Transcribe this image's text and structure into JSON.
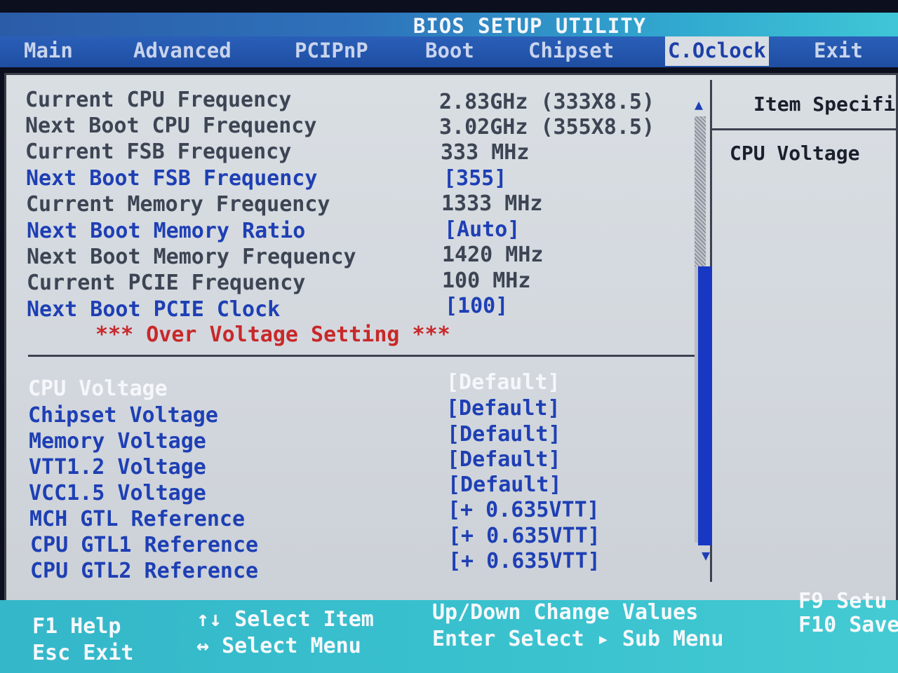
{
  "title": "BIOS SETUP UTILITY",
  "menu": [
    {
      "label": "Main"
    },
    {
      "label": "Advanced"
    },
    {
      "label": "PCIPnP"
    },
    {
      "label": "Boot"
    },
    {
      "label": "Chipset"
    },
    {
      "label": "C.Oclock",
      "active": true
    },
    {
      "label": "Exit"
    }
  ],
  "info_rows": [
    {
      "label": "Current CPU Frequency",
      "value": "2.83GHz (333X8.5)",
      "editable": false
    },
    {
      "label": "Next Boot CPU Frequency",
      "value": "3.02GHz (355X8.5)",
      "editable": false
    },
    {
      "label": "Current FSB Frequency",
      "value": "333 MHz",
      "editable": false
    },
    {
      "label": "Next Boot FSB Frequency",
      "value": "[355]",
      "editable": true
    },
    {
      "label": "Current Memory Frequency",
      "value": "1333 MHz",
      "editable": false
    },
    {
      "label": "Next Boot Memory Ratio",
      "value": "[Auto]",
      "editable": true
    },
    {
      "label": "Next Boot Memory Frequency",
      "value": "1420 MHz",
      "editable": false
    },
    {
      "label": "Current PCIE Frequency",
      "value": "100 MHz",
      "editable": false
    },
    {
      "label": "Next Boot PCIE Clock",
      "value": "[100]",
      "editable": true
    }
  ],
  "section_header": "*** Over Voltage Setting ***",
  "voltage_rows": [
    {
      "label": "CPU Voltage",
      "value": "[Default]",
      "selected": true
    },
    {
      "label": "Chipset Voltage",
      "value": "[Default]"
    },
    {
      "label": "Memory Voltage",
      "value": "[Default]"
    },
    {
      "label": "VTT1.2 Voltage",
      "value": "[Default]"
    },
    {
      "label": "VCC1.5 Voltage",
      "value": "[Default]"
    },
    {
      "label": "MCH GTL Reference",
      "value": "[+ 0.635VTT]"
    },
    {
      "label": "CPU GTL1 Reference",
      "value": "[+ 0.635VTT]"
    },
    {
      "label": "CPU GTL2 Reference",
      "value": "[+ 0.635VTT]"
    }
  ],
  "help_panel": {
    "title": "Item Specifi",
    "text": "CPU Voltage"
  },
  "scrollbar": {
    "up_arrow": "▲",
    "down_arrow": "▼"
  },
  "keys": {
    "f1": "F1  Help",
    "esc": "Esc Exit",
    "select_item": "↑↓ Select Item",
    "select_menu": "↔ Select Menu",
    "updown": "Up/Down Change Values",
    "enter": "Enter   Select ▸ Sub Menu",
    "f9": "F9  Setu",
    "f10": "F10 Save"
  },
  "colors": {
    "panel_bg": "#d5dadf",
    "menu_bg": "#2a5fb8",
    "status_bg": "#3ac2cf",
    "label_gray": "#3d4554",
    "label_blue": "#1e3fb4",
    "selected_white": "#f5f7fb",
    "warning_red": "#c8282a"
  }
}
